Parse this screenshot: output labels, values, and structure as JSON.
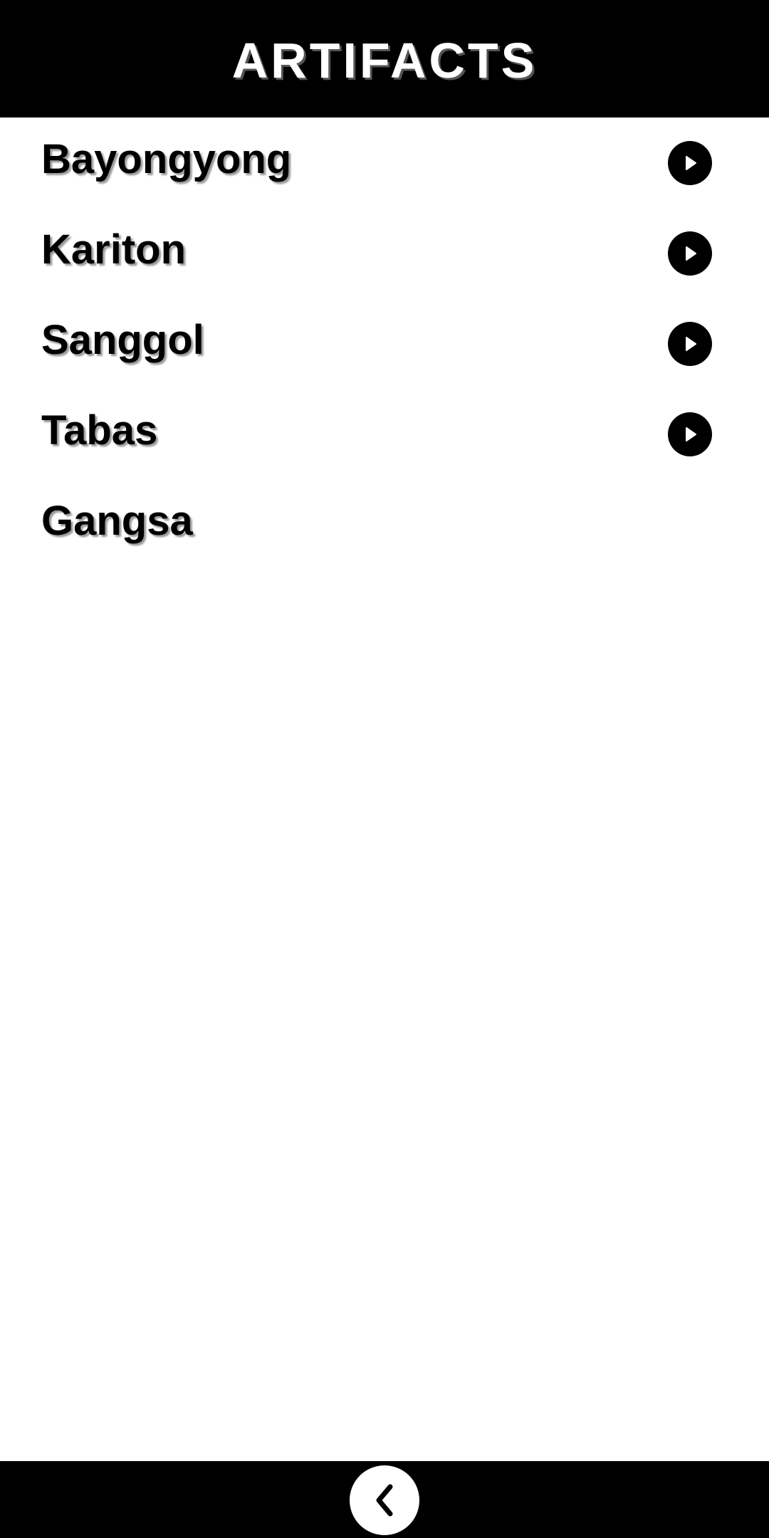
{
  "header": {
    "title": "ARTIFACTS"
  },
  "artifacts": {
    "items": [
      {
        "label": "Bayongyong",
        "icon": "play-circle-icon"
      },
      {
        "label": "Kariton",
        "icon": "play-circle-icon"
      },
      {
        "label": "Sanggol",
        "icon": "play-circle-icon"
      },
      {
        "label": "Tabas",
        "icon": "play-circle-icon"
      },
      {
        "label": "Gangsa"
      }
    ]
  },
  "footer": {
    "back_icon": "chevron-left-icon"
  },
  "colors": {
    "header_background": "#000000",
    "header_text": "#ffffff",
    "list_background": "#ffffff",
    "list_text": "#000000",
    "footer_background": "#000000"
  }
}
